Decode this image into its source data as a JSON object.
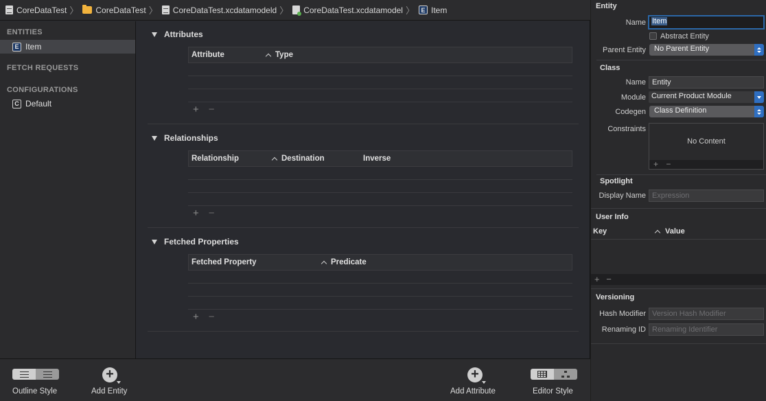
{
  "breadcrumb": [
    "CoreDataTest",
    "CoreDataTest",
    "CoreDataTest.xcdatamodeld",
    "CoreDataTest.xcdatamodel",
    "Item"
  ],
  "outline": {
    "entities_header": "ENTITIES",
    "entities": [
      "Item"
    ],
    "fetch_requests_header": "FETCH REQUESTS",
    "configurations_header": "CONFIGURATIONS",
    "configurations": [
      "Default"
    ]
  },
  "sections": {
    "attributes": {
      "title": "Attributes",
      "columns": [
        "Attribute",
        "Type"
      ]
    },
    "relationships": {
      "title": "Relationships",
      "columns": [
        "Relationship",
        "Destination",
        "Inverse"
      ]
    },
    "fetched": {
      "title": "Fetched Properties",
      "columns": [
        "Fetched Property",
        "Predicate"
      ]
    }
  },
  "controls": {
    "plus": "+",
    "minus": "−"
  },
  "bottombar": {
    "outline_style": "Outline Style",
    "add_entity": "Add Entity",
    "add_attribute": "Add Attribute",
    "editor_style": "Editor Style"
  },
  "inspector": {
    "entity_header": "Entity",
    "name_label": "Name",
    "name_value": "Item",
    "abstract_label": "Abstract Entity",
    "parent_label": "Parent Entity",
    "parent_value": "No Parent Entity",
    "class_header": "Class",
    "class_name_label": "Name",
    "class_name_value": "Entity",
    "module_label": "Module",
    "module_value": "Current Product Module",
    "codegen_label": "Codegen",
    "codegen_value": "Class Definition",
    "constraints_label": "Constraints",
    "constraints_empty": "No Content",
    "spotlight_header": "Spotlight",
    "display_name_label": "Display Name",
    "display_name_placeholder": "Expression",
    "user_info_header": "User Info",
    "key_col": "Key",
    "value_col": "Value",
    "versioning_header": "Versioning",
    "hash_label": "Hash Modifier",
    "hash_placeholder": "Version Hash Modifier",
    "renaming_label": "Renaming ID",
    "renaming_placeholder": "Renaming Identifier"
  },
  "colors": {
    "accent": "#2f6fc2",
    "focus_ring": "#2b67a8"
  }
}
